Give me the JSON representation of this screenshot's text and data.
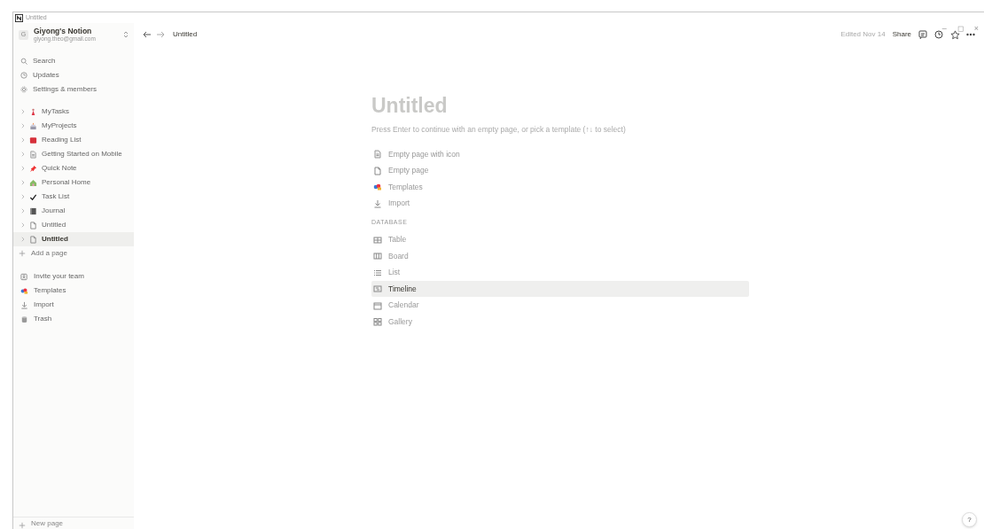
{
  "window": {
    "title": "Untitled",
    "controls": [
      "–",
      "◻",
      "×"
    ]
  },
  "workspace": {
    "name": "Giyong's Notion",
    "email": "giyong.theo@gmail.com",
    "initial": "G"
  },
  "sidebar": {
    "actions": [
      {
        "label": "Search",
        "kind": "search"
      },
      {
        "label": "Updates",
        "kind": "clock"
      },
      {
        "label": "Settings & members",
        "kind": "gear"
      }
    ],
    "pages": [
      {
        "label": "MyTasks",
        "kind": "figure",
        "selected": false
      },
      {
        "label": "MyProjects",
        "kind": "cake",
        "selected": false
      },
      {
        "label": "Reading List",
        "kind": "book",
        "selected": false
      },
      {
        "label": "Getting Started on Mobile",
        "kind": "doc",
        "selected": false
      },
      {
        "label": "Quick Note",
        "kind": "pin",
        "selected": false
      },
      {
        "label": "Personal Home",
        "kind": "house",
        "selected": false
      },
      {
        "label": "Task List",
        "kind": "check",
        "selected": false
      },
      {
        "label": "Journal",
        "kind": "notebook",
        "selected": false
      },
      {
        "label": "Untitled",
        "kind": "page",
        "selected": false
      },
      {
        "label": "Untitled",
        "kind": "page",
        "selected": true
      }
    ],
    "add_page": "Add a page",
    "tools": [
      {
        "label": "Invite your team",
        "kind": "invite"
      },
      {
        "label": "Templates",
        "kind": "templates"
      },
      {
        "label": "Import",
        "kind": "import"
      },
      {
        "label": "Trash",
        "kind": "trash"
      }
    ],
    "new_page": "New page"
  },
  "topbar": {
    "breadcrumb": "Untitled",
    "edited": "Edited Nov 14",
    "share": "Share"
  },
  "page": {
    "title": "Untitled",
    "hint": "Press Enter to continue with an empty page, or pick a template (↑↓ to select)",
    "options": [
      {
        "label": "Empty page with icon",
        "kind": "doc",
        "selected": false
      },
      {
        "label": "Empty page",
        "kind": "page",
        "selected": false
      },
      {
        "label": "Templates",
        "kind": "templates",
        "selected": false
      },
      {
        "label": "Import",
        "kind": "import",
        "selected": false
      }
    ],
    "database_heading": "DATABASE",
    "database": [
      {
        "label": "Table",
        "kind": "table",
        "selected": false
      },
      {
        "label": "Board",
        "kind": "board",
        "selected": false
      },
      {
        "label": "List",
        "kind": "list",
        "selected": false
      },
      {
        "label": "Timeline",
        "kind": "timeline",
        "selected": true
      },
      {
        "label": "Calendar",
        "kind": "calendar",
        "selected": false
      },
      {
        "label": "Gallery",
        "kind": "gallery",
        "selected": false
      }
    ]
  },
  "help": "?"
}
